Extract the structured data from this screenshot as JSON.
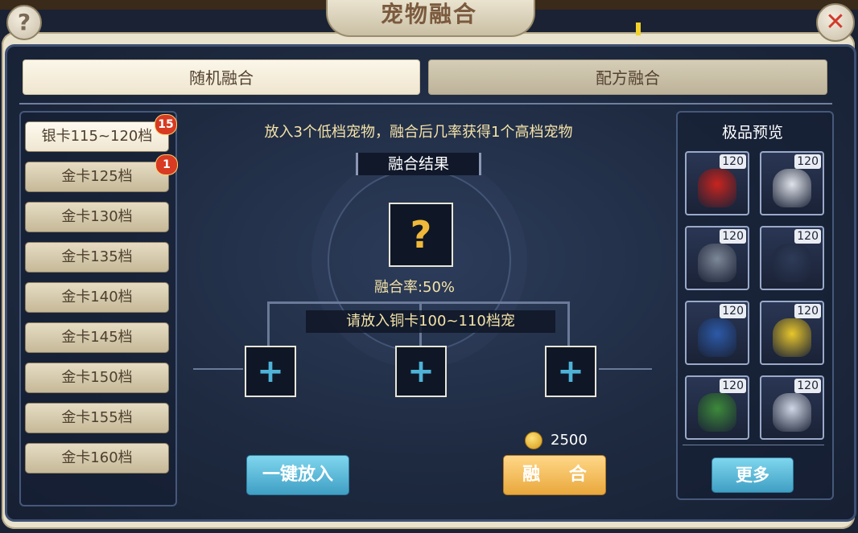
{
  "header": {
    "title": "宠物融合",
    "help": "?",
    "close": "✕"
  },
  "tabs": [
    {
      "label": "随机融合",
      "active": true
    },
    {
      "label": "配方融合",
      "active": false
    }
  ],
  "tiers": [
    {
      "label": "银卡115~120档",
      "badge": "15",
      "active": true
    },
    {
      "label": "金卡125档",
      "badge": "1"
    },
    {
      "label": "金卡130档"
    },
    {
      "label": "金卡135档"
    },
    {
      "label": "金卡140档"
    },
    {
      "label": "金卡145档"
    },
    {
      "label": "金卡150档"
    },
    {
      "label": "金卡155档"
    },
    {
      "label": "金卡160档"
    }
  ],
  "main": {
    "description": "放入3个低档宠物，融合后几率获得1个高档宠物",
    "result_label": "融合结果",
    "result_placeholder": "?",
    "rate": "融合率:50%",
    "slot_hint": "请放入铜卡100~110档宠",
    "slot_icon": "+",
    "cost": "2500",
    "quick_button": "一键放入",
    "fuse_button": "融 合"
  },
  "preview": {
    "title": "极品预览",
    "more_button": "更多",
    "pets": [
      {
        "level": "120",
        "color": "#c8241f"
      },
      {
        "level": "120",
        "color": "#dfe3ea"
      },
      {
        "level": "120",
        "color": "#7c8797"
      },
      {
        "level": "120",
        "color": "#2e3b58"
      },
      {
        "level": "120",
        "color": "#2d5aa8"
      },
      {
        "level": "120",
        "color": "#e8c62c"
      },
      {
        "level": "120",
        "color": "#3d8a3a"
      },
      {
        "level": "120",
        "color": "#cfd6e4"
      }
    ]
  }
}
